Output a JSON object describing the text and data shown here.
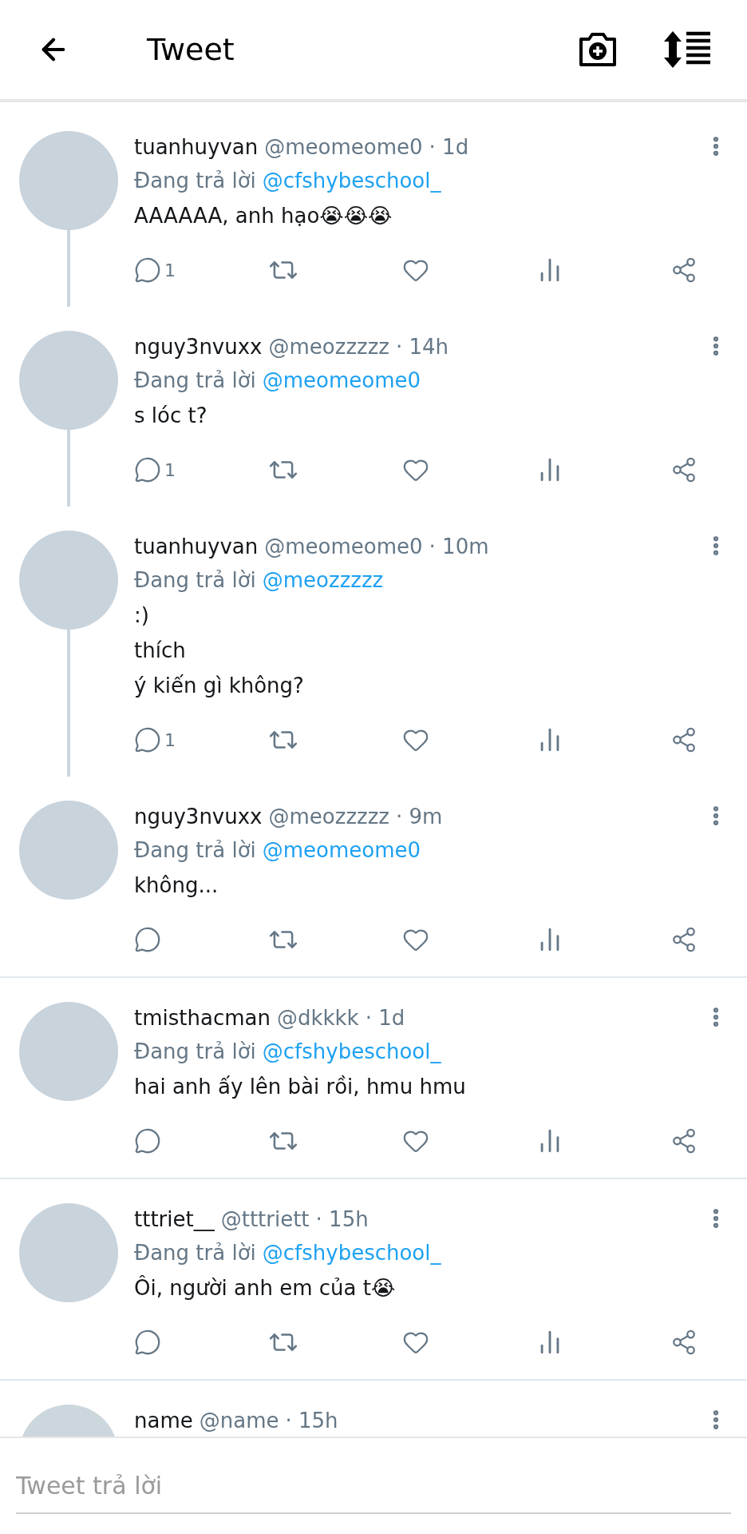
{
  "header": {
    "title": "Tweet"
  },
  "tweets": [
    {
      "name": "tuanhuyvan",
      "handle": "@meomeome0",
      "time": "· 1d",
      "reply_label": "Đang trả lời",
      "reply_to": "@cfshybeschool_",
      "lines": [
        "AAAAAA, anh hạo😭😭😭"
      ],
      "replies": "1",
      "avatar": {
        "kind": "photo"
      },
      "thread_below": true,
      "divider_below": false
    },
    {
      "name": "nguy3nvuxx",
      "handle": "@meozzzzz",
      "time": "· 14h",
      "reply_label": "Đang trả lời",
      "reply_to": "@meomeome0",
      "lines": [
        "s lóc t?"
      ],
      "replies": "1",
      "avatar": {
        "kind": "photo"
      },
      "thread_below": true,
      "divider_below": false
    },
    {
      "name": "tuanhuyvan",
      "handle": "@meomeome0",
      "time": "· 10m",
      "reply_label": "Đang trả lời",
      "reply_to": "@meozzzzz",
      "lines": [
        ":)",
        "thích",
        "ý kiến gì không?"
      ],
      "replies": "1",
      "avatar": {
        "kind": "photo"
      },
      "thread_below": true,
      "divider_below": false
    },
    {
      "name": "nguy3nvuxx",
      "handle": "@meozzzzz",
      "time": "· 9m",
      "reply_label": "Đang trả lời",
      "reply_to": "@meomeome0",
      "lines": [
        "không..."
      ],
      "avatar": {
        "kind": "photo"
      },
      "thread_below": false,
      "divider_below": true
    },
    {
      "name": "tmisthacman",
      "handle": "@dkkkk",
      "time": "· 1d",
      "reply_label": "Đang trả lời",
      "reply_to": "@cfshybeschool_",
      "lines": [
        "hai anh ấy lên bài rồi, hmu hmu"
      ],
      "avatar": {
        "kind": "photo"
      },
      "thread_below": false,
      "divider_below": true
    },
    {
      "name": "tttriet__",
      "handle": "@tttriett",
      "time": "· 15h",
      "reply_label": "Đang trả lời",
      "reply_to": "@cfshybeschool_",
      "lines": [
        "Ôi, người anh em của t😭"
      ],
      "avatar": {
        "kind": "photo"
      },
      "thread_below": false,
      "divider_below": true
    },
    {
      "name": "name",
      "handle": "@name",
      "time": "· 15h",
      "avatar": {
        "kind": "default"
      }
    }
  ],
  "composer": {
    "placeholder": "Tweet trả lời"
  }
}
